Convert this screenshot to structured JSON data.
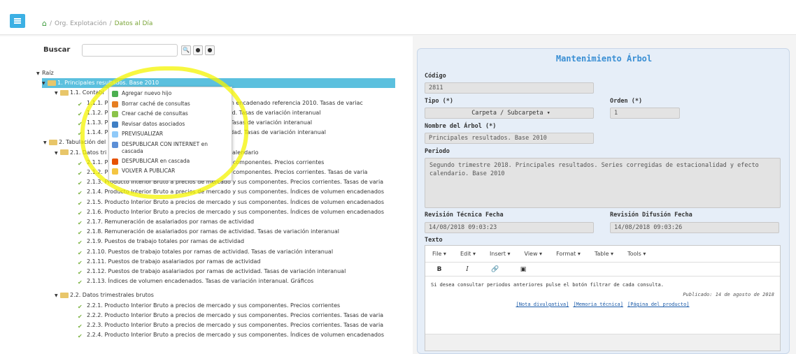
{
  "breadcrumb": {
    "root": "Org. Explotación",
    "current": "Datos al Día"
  },
  "search": {
    "label": "Buscar",
    "value": ""
  },
  "tree": [
    {
      "text": "Raíz",
      "indent": 0,
      "type": "caret"
    },
    {
      "text": "1. Principales resultados. Base 2010",
      "indent": 1,
      "type": "folder",
      "selected": true
    },
    {
      "text": "1.1. Contabi",
      "indent": 2,
      "type": "folder"
    },
    {
      "text": "1.1.1. P",
      "tail": "Volumen encadenado referencia 2010. Tasas de variac",
      "indent": 3,
      "type": "leaf"
    },
    {
      "text": "1.1.2. P",
      "tail": "actividad. Tasas de variación interanual",
      "indent": 3,
      "type": "leaf"
    },
    {
      "text": "1.1.3. P",
      "tail": "ividad. Tasas de variación interanual",
      "indent": 3,
      "type": "leaf"
    },
    {
      "text": "1.1.4. P",
      "tail": "e actividad. Tasas de variación interanual",
      "indent": 3,
      "type": "leaf"
    },
    {
      "text": "2. Tabulación del",
      "indent": 1,
      "type": "folder"
    },
    {
      "text": "2.1. Datos tri",
      "tail": "efecto calendario",
      "indent": 2,
      "type": "folder"
    },
    {
      "text": "2.1.1. P",
      "tail": "lo y sus componentes. Precios corrientes",
      "indent": 3,
      "type": "leaf"
    },
    {
      "text": "2.1.2. P",
      "tail": "lo y sus componentes. Precios corrientes. Tasas de varia",
      "indent": 3,
      "type": "leaf"
    },
    {
      "text": "2.1.3. Producto Interior Bruto a precios de mercado y sus componentes. Precios corrientes. Tasas de varia",
      "indent": 3,
      "type": "leaf"
    },
    {
      "text": "2.1.4. Producto Interior Bruto a precios de mercado y sus componentes. Índices de volumen encadenados",
      "indent": 3,
      "type": "leaf"
    },
    {
      "text": "2.1.5. Producto Interior Bruto a precios de mercado y sus componentes. Índices de volumen encadenados",
      "indent": 3,
      "type": "leaf"
    },
    {
      "text": "2.1.6. Producto Interior Bruto a precios de mercado y sus componentes. Índices de volumen encadenados",
      "indent": 3,
      "type": "leaf"
    },
    {
      "text": "2.1.7. Remuneración de asalariados por ramas de actividad",
      "indent": 3,
      "type": "leaf"
    },
    {
      "text": "2.1.8. Remuneración de asalariados por ramas de actividad. Tasas de variación interanual",
      "indent": 3,
      "type": "leaf"
    },
    {
      "text": "2.1.9. Puestos de trabajo totales por ramas de actividad",
      "indent": 3,
      "type": "leaf"
    },
    {
      "text": "2.1.10. Puestos de trabajo totales por ramas de actividad. Tasas de variación interanual",
      "indent": 3,
      "type": "leaf"
    },
    {
      "text": "2.1.11. Puestos de trabajo asalariados por ramas de actividad",
      "indent": 3,
      "type": "leaf"
    },
    {
      "text": "2.1.12. Puestos de trabajo asalariados por ramas de actividad. Tasas de variación interanual",
      "indent": 3,
      "type": "leaf"
    },
    {
      "text": "2.1.13. Índices de volumen encadenados. Tasas de variación interanual. Gráficos",
      "indent": 3,
      "type": "leaf"
    },
    {
      "text": "2.2. Datos trimestrales brutos",
      "indent": 2,
      "type": "folder",
      "gap": true
    },
    {
      "text": "2.2.1. Producto Interior Bruto a precios de mercado y sus componentes. Precios corrientes",
      "indent": 3,
      "type": "leaf"
    },
    {
      "text": "2.2.2. Producto Interior Bruto a precios de mercado y sus componentes. Precios corrientes. Tasas de varia",
      "indent": 3,
      "type": "leaf"
    },
    {
      "text": "2.2.3. Producto Interior Bruto a precios de mercado y sus componentes. Precios corrientes. Tasas de varia",
      "indent": 3,
      "type": "leaf"
    },
    {
      "text": "2.2.4. Producto Interior Bruto a precios de mercado y sus componentes. Índices de volumen encadenados",
      "indent": 3,
      "type": "leaf"
    }
  ],
  "context_menu": [
    {
      "label": "Agregar nuevo hijo",
      "icon": "plus-icon",
      "color": "#4caf50"
    },
    {
      "label": "Borrar caché de consultas",
      "icon": "broom-icon",
      "color": "#e67e22"
    },
    {
      "label": "Crear caché de consultas",
      "icon": "cache-icon",
      "color": "#8bc34a"
    },
    {
      "label": "Revisar datos asociados",
      "icon": "table-icon",
      "color": "#3f7fc4"
    },
    {
      "label": "PREVISUALIZAR",
      "icon": "preview-icon",
      "color": "#90caf9"
    },
    {
      "label": "DESPUBLICAR CON INTERNET en cascada",
      "icon": "globe-icon",
      "color": "#5c8fd6",
      "two": true
    },
    {
      "label": "DESPUBLICAR en cascada",
      "icon": "unpublish-icon",
      "color": "#e65100"
    },
    {
      "label": "VOLVER A PUBLICAR",
      "icon": "republish-icon",
      "color": "#f4c542"
    }
  ],
  "form": {
    "title": "Mantenimiento Árbol",
    "codigo_label": "Código",
    "codigo": "2811",
    "tipo_label": "Tipo (*)",
    "tipo": "Carpeta / Subcarpeta",
    "orden_label": "Orden (*)",
    "orden": "1",
    "nombre_label": "Nombre del Árbol (*)",
    "nombre": "Principales resultados. Base 2010",
    "periodo_label": "Periodo",
    "periodo": "Segundo trimestre 2018. Principales resultados. Series corregidas de estacionalidad y efecto calendario. Base 2010",
    "rev_tec_label": "Revisión Técnica Fecha",
    "rev_tec": "14/08/2018 09:03:23",
    "rev_dif_label": "Revisión Difusión Fecha",
    "rev_dif": "14/08/2018 09:03:26",
    "texto_label": "Texto"
  },
  "editor": {
    "menus": [
      "File ▾",
      "Edit ▾",
      "Insert ▾",
      "View ▾",
      "Format ▾",
      "Table ▾",
      "Tools ▾"
    ],
    "body": "Si desea consultar periodos anteriores pulse el botón filtrar de cada consulta.",
    "published": "Publicado: 14 de agosto de 2018",
    "links": [
      "[Nota divulgativa]",
      "[Memoria técnica]",
      "[Página del producto]"
    ]
  }
}
